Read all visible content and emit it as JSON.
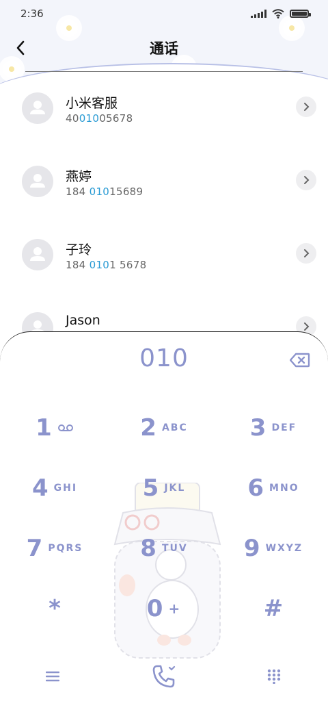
{
  "status_bar": {
    "time": "2:36"
  },
  "header": {
    "title": "通话"
  },
  "contacts": [
    {
      "name": "小米客服",
      "number_pre": "40",
      "number_match": "010",
      "number_post": "05678"
    },
    {
      "name": "燕婷",
      "number_pre": "184 ",
      "number_match": "010",
      "number_post": "15689"
    },
    {
      "name": "子玲",
      "number_pre": "184 ",
      "number_match": "010",
      "number_post": "1 5678"
    },
    {
      "name": "Jason",
      "number_pre": "",
      "number_match": "",
      "number_post": ""
    }
  ],
  "dialer": {
    "display": "010",
    "keys": [
      {
        "digit": "1",
        "letters": ""
      },
      {
        "digit": "2",
        "letters": "ABC"
      },
      {
        "digit": "3",
        "letters": "DEF"
      },
      {
        "digit": "4",
        "letters": "GHI"
      },
      {
        "digit": "5",
        "letters": "JKL"
      },
      {
        "digit": "6",
        "letters": "MNO"
      },
      {
        "digit": "7",
        "letters": "PQRS"
      },
      {
        "digit": "8",
        "letters": "TUV"
      },
      {
        "digit": "9",
        "letters": "WXYZ"
      },
      {
        "digit": "*",
        "letters": ""
      },
      {
        "digit": "0",
        "letters": "+"
      },
      {
        "digit": "#",
        "letters": ""
      }
    ],
    "accent_color": "#8b93cc"
  },
  "colors": {
    "highlight": "#2a9bd4",
    "accent": "#8b93cc"
  },
  "icons": [
    "back-arrow-icon",
    "signal-icon",
    "wifi-icon",
    "battery-icon",
    "avatar-icon",
    "chevron-right-icon",
    "backspace-icon",
    "voicemail-icon",
    "menu-icon",
    "phone-icon",
    "keypad-icon"
  ]
}
